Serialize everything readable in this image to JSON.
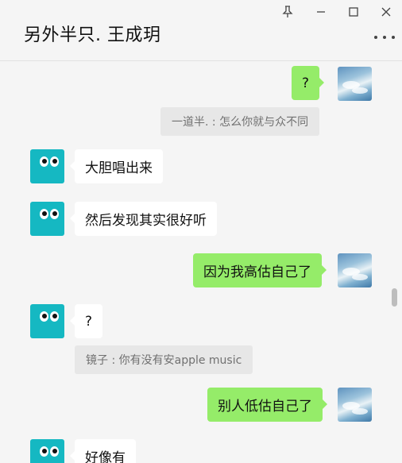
{
  "window": {
    "title": "另外半只. 王成玥"
  },
  "controls": {
    "pin": "⚲",
    "minimize": "—",
    "maximize": "☐",
    "close": "✕"
  },
  "messages": [
    {
      "side": "out",
      "text": "?"
    },
    {
      "quote": "一道半. : 怎么你就与众不同"
    },
    {
      "side": "in",
      "text": "大胆唱出来"
    },
    {
      "side": "in",
      "text": "然后发现其实很好听"
    },
    {
      "side": "out",
      "text": "因为我高估自己了"
    },
    {
      "side": "in",
      "text": "?"
    },
    {
      "quote": "镜子 : 你有没有安apple music"
    },
    {
      "side": "out",
      "text": "别人低估自己了"
    },
    {
      "side": "in",
      "text": "好像有"
    }
  ],
  "icons": {
    "pin": "pin-icon",
    "minimize": "minimize-icon",
    "maximize": "maximize-icon",
    "close": "close-icon",
    "more": "more-dots-icon"
  },
  "colors": {
    "background": "#f5f5f5",
    "incoming_bubble": "#ffffff",
    "outgoing_bubble": "#95ec69",
    "quote_bg": "#e7e7e7",
    "avatar_teal": "#15b8c2"
  }
}
